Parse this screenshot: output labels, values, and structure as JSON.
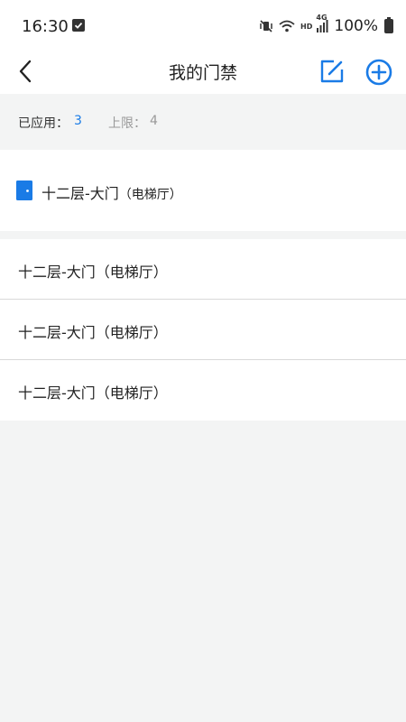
{
  "status_bar": {
    "time": "16:30",
    "battery": "100%",
    "network": "4G",
    "hd_label": "HD"
  },
  "nav": {
    "title": "我的门禁"
  },
  "summary": {
    "applied_label": "已应用：",
    "applied_value": "3",
    "limit_label": "上限：",
    "limit_value": "4"
  },
  "current_door": {
    "name": "十二层-大门",
    "suffix": "（电梯厅）",
    "icon": "door-icon"
  },
  "door_list": [
    {
      "label": "十二层-大门（电梯厅）"
    },
    {
      "label": "十二层-大门（电梯厅）"
    },
    {
      "label": "十二层-大门（电梯厅）"
    }
  ],
  "colors": {
    "accent": "#1a7be6",
    "background": "#f3f4f4",
    "muted": "#999999"
  }
}
